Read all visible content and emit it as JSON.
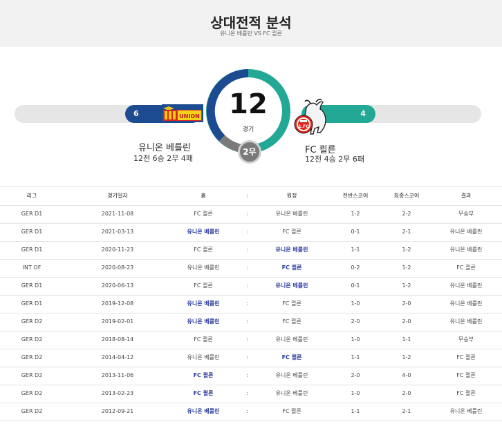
{
  "header": {
    "title": "상대전적 분석",
    "subtitle": "유니온 베를린 VS FC 쾰른"
  },
  "summary": {
    "total": "12",
    "total_label": "경기",
    "draws": "2무",
    "home": {
      "name": "유니온 베를린",
      "record": "12전 6승 2무 4패",
      "wins": "6"
    },
    "away": {
      "name": "FC 쾰른",
      "record": "12전 4승 2무 6패",
      "wins": "4"
    }
  },
  "colors": {
    "home": "#1d4b91",
    "away": "#24a896",
    "draw": "#7a7a7a"
  },
  "table": {
    "headers": {
      "league": "리그",
      "date": "경기일자",
      "home": "홈",
      "sep": ":",
      "away": "원정",
      "half": "전반스코어",
      "full": "최종스코어",
      "result": "결과"
    },
    "rows": [
      {
        "league": "GER D1",
        "date": "2021-11-08",
        "home": "FC 쾰른",
        "sep": ":",
        "away": "유니온 베를린",
        "half": "1-2",
        "full": "2-2",
        "result": "무승부"
      },
      {
        "league": "GER D1",
        "date": "2021-03-13",
        "home": "유니온 베를린",
        "sep": ":",
        "away": "FC 쾰른",
        "half": "0-1",
        "full": "2-1",
        "result": "유니온 베를린"
      },
      {
        "league": "GER D1",
        "date": "2020-11-23",
        "home": "FC 쾰른",
        "sep": ":",
        "away": "유니온 베를린",
        "half": "1-1",
        "full": "1-2",
        "result": "유니온 베를린"
      },
      {
        "league": "INT OF",
        "date": "2020-08-23",
        "home": "유니온 베를린",
        "sep": ":",
        "away": "FC 쾰른",
        "half": "0-2",
        "full": "1-2",
        "result": "FC 쾰른"
      },
      {
        "league": "GER D1",
        "date": "2020-06-13",
        "home": "FC 쾰른",
        "sep": ":",
        "away": "유니온 베를린",
        "half": "0-1",
        "full": "1-2",
        "result": "유니온 베를린"
      },
      {
        "league": "GER D1",
        "date": "2019-12-08",
        "home": "유니온 베를린",
        "sep": ":",
        "away": "FC 쾰른",
        "half": "1-0",
        "full": "2-0",
        "result": "유니온 베를린"
      },
      {
        "league": "GER D2",
        "date": "2019-02-01",
        "home": "유니온 베를린",
        "sep": ":",
        "away": "FC 쾰른",
        "half": "2-0",
        "full": "2-0",
        "result": "유니온 베를린"
      },
      {
        "league": "GER D2",
        "date": "2018-08-14",
        "home": "FC 쾰른",
        "sep": ":",
        "away": "유니온 베를린",
        "half": "1-0",
        "full": "1-1",
        "result": "무승부"
      },
      {
        "league": "GER D2",
        "date": "2014-04-12",
        "home": "유니온 베를린",
        "sep": ":",
        "away": "FC 쾰른",
        "half": "1-1",
        "full": "1-2",
        "result": "FC 쾰른"
      },
      {
        "league": "GER D2",
        "date": "2013-11-06",
        "home": "FC 쾰른",
        "sep": ":",
        "away": "유니온 베를린",
        "half": "2-0",
        "full": "4-0",
        "result": "FC 쾰른"
      },
      {
        "league": "GER D2",
        "date": "2013-02-23",
        "home": "FC 쾰른",
        "sep": ":",
        "away": "유니온 베를린",
        "half": "1-0",
        "full": "2-0",
        "result": "FC 쾰른"
      },
      {
        "league": "GER D2",
        "date": "2012-09-21",
        "home": "유니온 베를린",
        "sep": ":",
        "away": "FC 쾰른",
        "half": "1-1",
        "full": "2-1",
        "result": "유니온 베를린"
      }
    ]
  },
  "logos": {
    "home_icon": "union-berlin-logo",
    "away_icon": "fc-koln-logo",
    "home_text": "UNION"
  }
}
